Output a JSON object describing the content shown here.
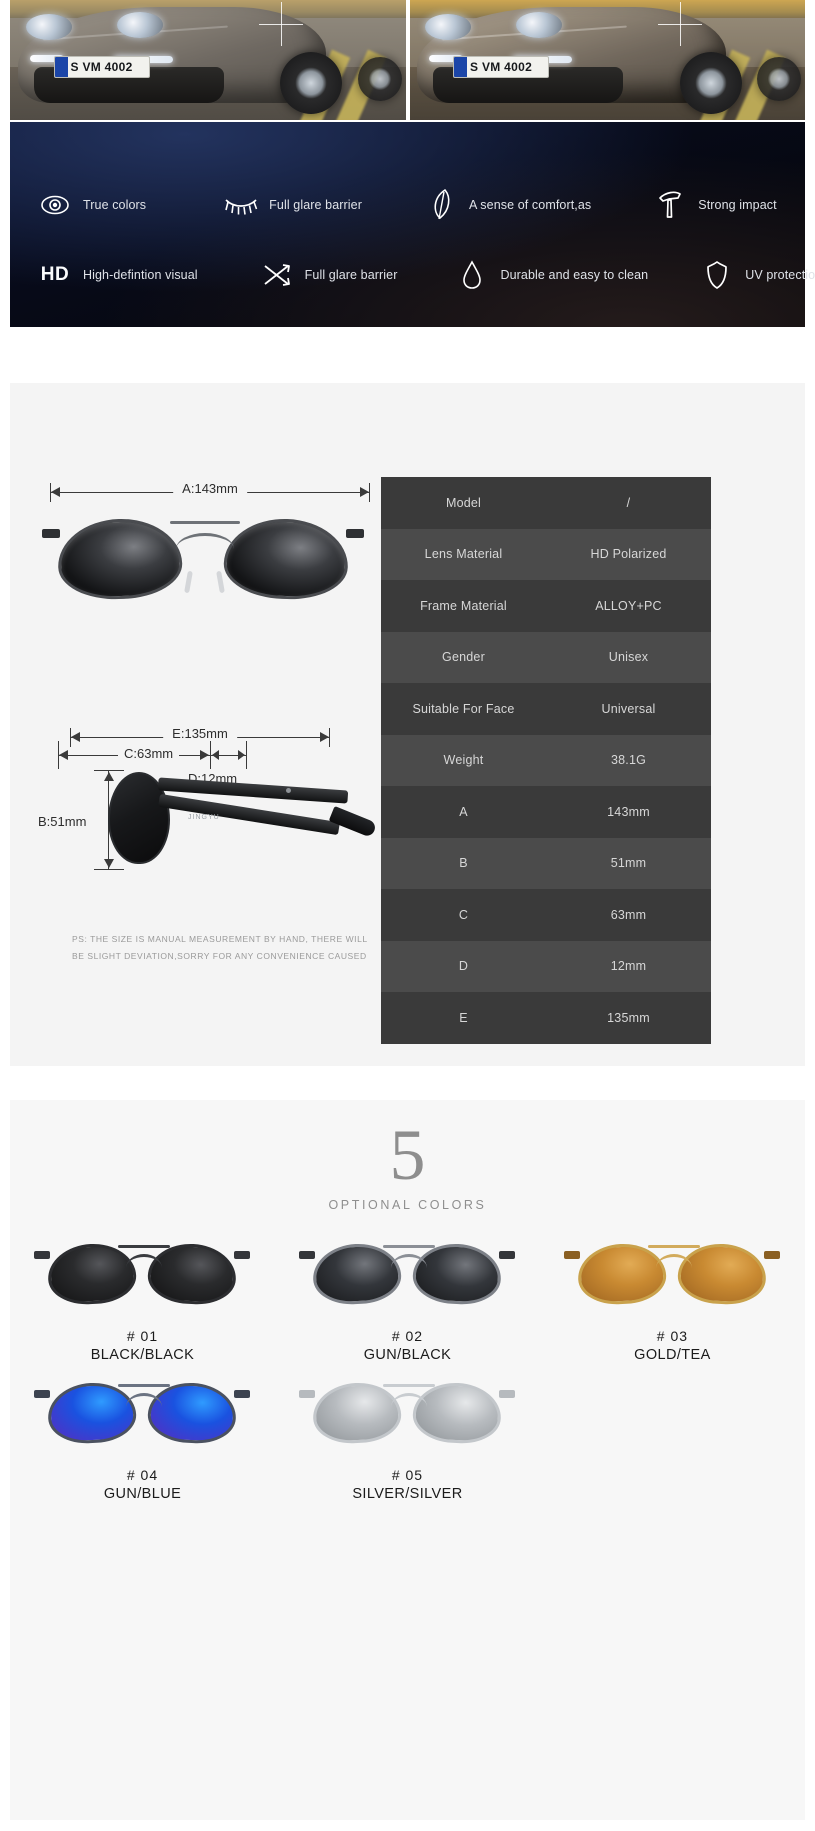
{
  "hero": {
    "photos": [
      {
        "name": "car-photo-normal",
        "plate": "S VM 4002",
        "caption": ""
      },
      {
        "name": "car-photo-polarized",
        "plate": "S VM 4002",
        "caption": ""
      }
    ]
  },
  "features_banner": {
    "rows": [
      [
        {
          "icon": "eye-icon",
          "label": "True colors"
        },
        {
          "icon": "eyelash-icon",
          "label": "Full glare barrier"
        },
        {
          "icon": "feather-icon",
          "label": "A sense of comfort,as"
        },
        {
          "icon": "hammer-icon",
          "label": "Strong impact"
        }
      ],
      [
        {
          "icon": "hd-text-icon",
          "label": "High-defintion visual",
          "icon_text": "HD"
        },
        {
          "icon": "shuffle-arrows-icon",
          "label": "Full glare barrier"
        },
        {
          "icon": "water-drop-icon",
          "label": "Durable and easy to clean"
        },
        {
          "icon": "shield-icon",
          "label": "UV protection"
        }
      ]
    ]
  },
  "dimensions": {
    "front_width": "A:143mm",
    "lens_width": "C:63mm",
    "bridge_width": "D:12mm",
    "temple_length": "E:135mm",
    "lens_height": "B:51mm",
    "ps_note_line1": "PS: THE SIZE IS MANUAL MEASUREMENT BY HAND, THERE WILL",
    "ps_note_line2": "BE SLIGHT DEVIATION,SORRY FOR ANY CONVENIENCE CAUSED"
  },
  "spec_table": {
    "rows": [
      {
        "key": "Model",
        "value": "/"
      },
      {
        "key": "Lens Material",
        "value": "HD Polarized"
      },
      {
        "key": "Frame Material",
        "value": "ALLOY+PC"
      },
      {
        "key": "Gender",
        "value": "Unisex"
      },
      {
        "key": "Suitable For Face",
        "value": "Universal"
      },
      {
        "key": "Weight",
        "value": "38.1G"
      },
      {
        "key": "A",
        "value": "143mm"
      },
      {
        "key": "B",
        "value": "51mm"
      },
      {
        "key": "C",
        "value": "63mm"
      },
      {
        "key": "D",
        "value": "12mm"
      },
      {
        "key": "E",
        "value": "135mm"
      }
    ]
  },
  "colors_section": {
    "count": "5",
    "caption": "OPTIONAL COLORS",
    "items": [
      {
        "code": "#  01",
        "name": "BLACK/BLACK",
        "lens_color": "#1a1a1c",
        "frame_color": "#262629"
      },
      {
        "code": "#  02",
        "name": "GUN/BLACK",
        "lens_color": "#2a2d33",
        "frame_color": "#6e737a"
      },
      {
        "code": "#  03",
        "name": "GOLD/TEA",
        "lens_color": "#b5762a",
        "frame_color": "#c79a4a"
      },
      {
        "code": "#  04",
        "name": "GUN/BLUE",
        "lens_color": "#1b48c8",
        "frame_color": "#5d6470"
      },
      {
        "code": "#  05",
        "name": "SILVER/SILVER",
        "lens_color": "#a9adb2",
        "frame_color": "#c6cace"
      }
    ]
  }
}
